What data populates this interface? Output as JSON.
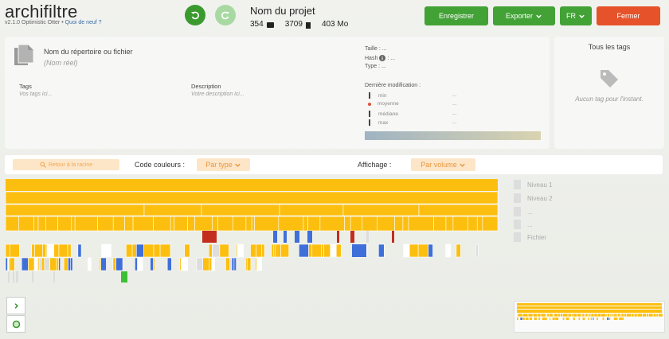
{
  "app": {
    "name": "archifiltre",
    "version": "v2.1.0 Optimistic Otter",
    "separator": "•",
    "whats_new": "Quoi de neuf ?"
  },
  "project": {
    "title": "Nom du projet",
    "folders": "354",
    "files": "3709",
    "size": "403 Mo"
  },
  "header_buttons": {
    "save": "Enregistrer",
    "export": "Exporter",
    "lang": "FR",
    "close": "Fermer"
  },
  "info": {
    "name": "Nom du répertoire ou fichier",
    "real_name": "(Nom réel)",
    "tags_label": "Tags",
    "tags_placeholder": "Vos tags ici...",
    "desc_label": "Description",
    "desc_placeholder": "Votre description ici...",
    "size_label": "Taille : ...",
    "hash_label": "Hash",
    "hash_value": ": ...",
    "type_label": "Type : ...",
    "last_mod_label": "Dernière modification :",
    "stats": [
      {
        "label": "min",
        "value": "..."
      },
      {
        "label": "moyenne",
        "value": "..."
      },
      {
        "label": "médiane",
        "value": "..."
      },
      {
        "label": "max",
        "value": "..."
      }
    ]
  },
  "tags_panel": {
    "title": "Tous les tags",
    "empty": "Aucun tag pour l'instant."
  },
  "toolbar": {
    "back": "Retour à la racine",
    "color_label": "Code couleurs :",
    "color_value": "Par type",
    "display_label": "Affichage :",
    "display_value": "Par volume"
  },
  "levels": [
    "Niveau 1",
    "Niveau 2",
    "...",
    "...",
    "Fichier"
  ],
  "colors": {
    "green": "#43a236",
    "orange": "#e6532a",
    "folder": "#fcbf0f",
    "blue": "#3f6fd8",
    "red": "#c22d1e",
    "green_file": "#3cbf34"
  },
  "icons": {
    "undo": "undo-icon",
    "redo": "redo-icon",
    "folder": "folder-icon",
    "file": "file-icon",
    "document": "document-icon",
    "info": "info-icon",
    "tag": "tag-icon",
    "search": "search-icon",
    "chevron": "chevron-down-icon",
    "expand": "chevron-right-icon",
    "loader": "spinner-icon"
  }
}
